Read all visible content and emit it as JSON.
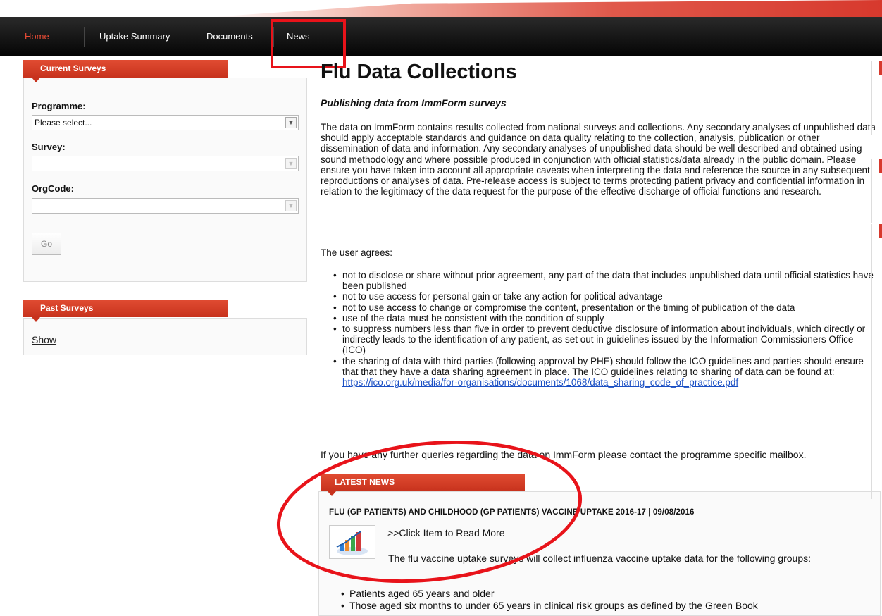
{
  "nav": {
    "items": [
      {
        "label": "Home",
        "active": true
      },
      {
        "label": "Uptake Summary",
        "active": false
      },
      {
        "label": "Documents",
        "active": false
      },
      {
        "label": "News",
        "active": false
      }
    ]
  },
  "current_surveys": {
    "title": "Current Surveys",
    "programme_label": "Programme:",
    "programme_value": "Please select...",
    "survey_label": "Survey:",
    "survey_value": "",
    "orgcode_label": "OrgCode:",
    "orgcode_value": "",
    "go_label": "Go"
  },
  "past_surveys": {
    "title": "Past Surveys",
    "show_label": "Show"
  },
  "main": {
    "title": "Flu Data Collections",
    "subtitle": "Publishing data from ImmForm surveys",
    "intro": "The data on ImmForm contains results collected from national surveys and collections. Any secondary analyses of unpublished data should apply acceptable standards and guidance on data quality relating to the collection, analysis, publication or other dissemination of data and information. Any secondary analyses of unpublished data should be well described and obtained using sound methodology and where possible produced in conjunction with official statistics/data already in the public domain. Please ensure you have taken into account all appropriate caveats when interpreting the data and reference the source in any subsequent reproductions or analyses of data. Pre-release access is subject to terms protecting patient privacy and confidential information in relation to the legitimacy of the data request for the purpose of the effective discharge of official functions and research.",
    "agrees": "The user agrees:",
    "bullets": [
      "not to disclose or share without prior agreement, any part of the data that includes unpublished data until official statistics have been published",
      "not to use access for personal gain or take any action for political advantage",
      "not to use access to change or compromise the content, presentation or the timing of publication of the data",
      "use of the data must be consistent with the condition of supply",
      "to suppress numbers less than five in order to prevent deductive disclosure of information about individuals, which directly or indirectly leads to the identification of any patient, as set out in guidelines issued by the Information Commissioners Office (ICO)"
    ],
    "last_bullet_text": "the sharing of data with third parties (following approval by PHE) should follow the ICO guidelines and parties should ensure that that they have a data sharing agreement in place. The ICO guidelines relating to sharing of data can be found at: ",
    "ico_link": "https://ico.org.uk/media/for-organisations/documents/1068/data_sharing_code_of_practice.pdf",
    "queries": "If you have any further queries regarding the data on ImmForm please contact the programme specific mailbox."
  },
  "latest_news": {
    "title": "LATEST NEWS",
    "headline": "FLU (GP PATIENTS) AND CHILDHOOD (GP PATIENTS) VACCINE UPTAKE 2016-17 | 09/08/2016",
    "read_more": ">>Click Item to Read More",
    "description": "The flu vaccine uptake surveys will collect influenza vaccine uptake data for the following groups:",
    "bullets": [
      "Patients aged 65 years and older",
      "Those aged six months to under 65 years in clinical risk groups as defined by the Green Book"
    ]
  },
  "colors": {
    "accent": "#d7392d",
    "annotation": "#e8131a",
    "nav_bg": "#111111",
    "link": "#1a4fc4"
  }
}
